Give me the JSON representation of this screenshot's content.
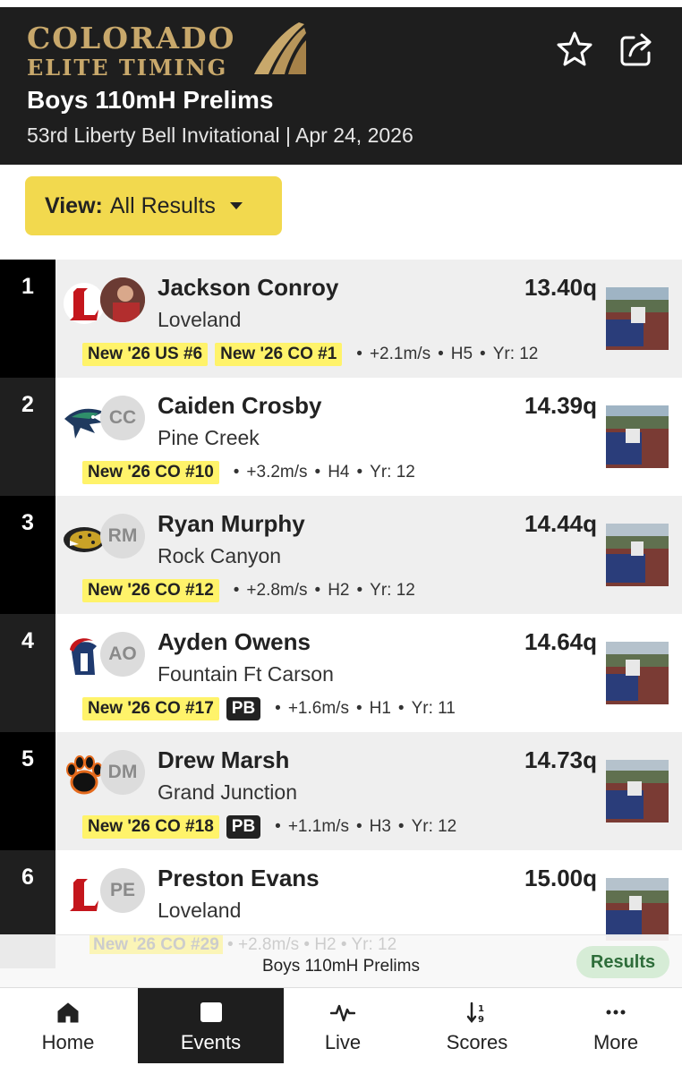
{
  "header": {
    "logo_line1": "COLORADO",
    "logo_line2": "ELITE TIMING",
    "title": "Boys 110mH Prelims",
    "subtitle": "53rd Liberty Bell Invitational | Apr 24, 2026"
  },
  "view": {
    "label": "View:",
    "value": "All Results"
  },
  "results": [
    {
      "place": "1",
      "name": "Jackson Conroy",
      "team": "Loveland",
      "mark": "13.40q",
      "avatar": "",
      "badges": [
        "New '26 US #6",
        "New '26 CO #1"
      ],
      "pb": "",
      "wind": "+2.1m/s",
      "heat": "H5",
      "year": "Yr: 12"
    },
    {
      "place": "2",
      "name": "Caiden Crosby",
      "team": "Pine Creek",
      "mark": "14.39q",
      "avatar": "CC",
      "badges": [
        "New '26 CO #10"
      ],
      "pb": "",
      "wind": "+3.2m/s",
      "heat": "H4",
      "year": "Yr: 12"
    },
    {
      "place": "3",
      "name": "Ryan Murphy",
      "team": "Rock Canyon",
      "mark": "14.44q",
      "avatar": "RM",
      "badges": [
        "New '26 CO #12"
      ],
      "pb": "",
      "wind": "+2.8m/s",
      "heat": "H2",
      "year": "Yr: 12"
    },
    {
      "place": "4",
      "name": "Ayden Owens",
      "team": "Fountain Ft Carson",
      "mark": "14.64q",
      "avatar": "AO",
      "badges": [
        "New '26 CO #17"
      ],
      "pb": "PB",
      "wind": "+1.6m/s",
      "heat": "H1",
      "year": "Yr: 11"
    },
    {
      "place": "5",
      "name": "Drew Marsh",
      "team": "Grand Junction",
      "mark": "14.73q",
      "avatar": "DM",
      "badges": [
        "New '26 CO #18"
      ],
      "pb": "PB",
      "wind": "+1.1m/s",
      "heat": "H3",
      "year": "Yr: 12"
    },
    {
      "place": "6",
      "name": "Preston Evans",
      "team": "Loveland",
      "mark": "15.00q",
      "avatar": "PE",
      "badges": [
        "New '26 CO #29"
      ],
      "pb": "",
      "wind": "+2.8m/s",
      "heat": "H2",
      "year": "Yr: 12"
    }
  ],
  "sticky": {
    "title": "Boys 110mH Prelims",
    "button": "Results"
  },
  "nav": [
    {
      "label": "Home",
      "icon": "home-icon"
    },
    {
      "label": "Events",
      "icon": "list-icon"
    },
    {
      "label": "Live",
      "icon": "pulse-icon"
    },
    {
      "label": "Scores",
      "icon": "sort-icon"
    },
    {
      "label": "More",
      "icon": "dots-icon"
    }
  ],
  "colors": {
    "header_bg": "#1e1e1e",
    "gold": "#c8a86b",
    "view_button": "#f2d94e",
    "badge": "#fff36a",
    "results_pill": "#d6ecd6"
  }
}
